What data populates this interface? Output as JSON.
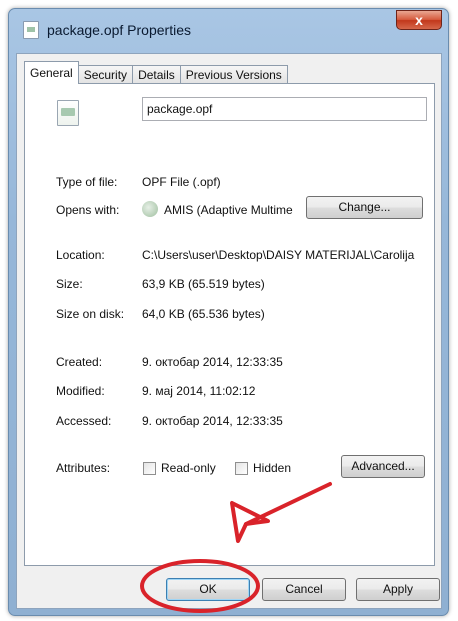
{
  "window": {
    "title": "package.opf Properties",
    "close_glyph": "x"
  },
  "tabs": [
    {
      "label": "General",
      "active": true
    },
    {
      "label": "Security",
      "active": false
    },
    {
      "label": "Details",
      "active": false
    },
    {
      "label": "Previous Versions",
      "active": false
    }
  ],
  "general": {
    "filename": "package.opf",
    "type_label": "Type of file:",
    "type_value": "OPF File (.opf)",
    "opens_label": "Opens with:",
    "opens_value": "AMIS (Adaptive Multime",
    "change_button": "Change...",
    "location_label": "Location:",
    "location_value": "C:\\Users\\user\\Desktop\\DAISY MATERIJAL\\Carolija",
    "size_label": "Size:",
    "size_value": "63,9 KB (65.519 bytes)",
    "size_on_disk_label": "Size on disk:",
    "size_on_disk_value": "64,0 KB (65.536 bytes)",
    "created_label": "Created:",
    "created_value": "9. октобар 2014, 12:33:35",
    "modified_label": "Modified:",
    "modified_value": "9. мај 2014, 11:02:12",
    "accessed_label": "Accessed:",
    "accessed_value": "9. октобар 2014, 12:33:35",
    "attributes_label": "Attributes:",
    "readonly_label": "Read-only",
    "hidden_label": "Hidden",
    "advanced_button": "Advanced..."
  },
  "footer": {
    "ok_button": "OK",
    "cancel_button": "Cancel",
    "apply_button": "Apply"
  },
  "colors": {
    "annotation": "#d9232a",
    "title_bar": "#a9c6e4"
  },
  "icons": {
    "title": "document-icon",
    "file": "opf-file-icon",
    "opens_with": "amis-app-icon"
  }
}
